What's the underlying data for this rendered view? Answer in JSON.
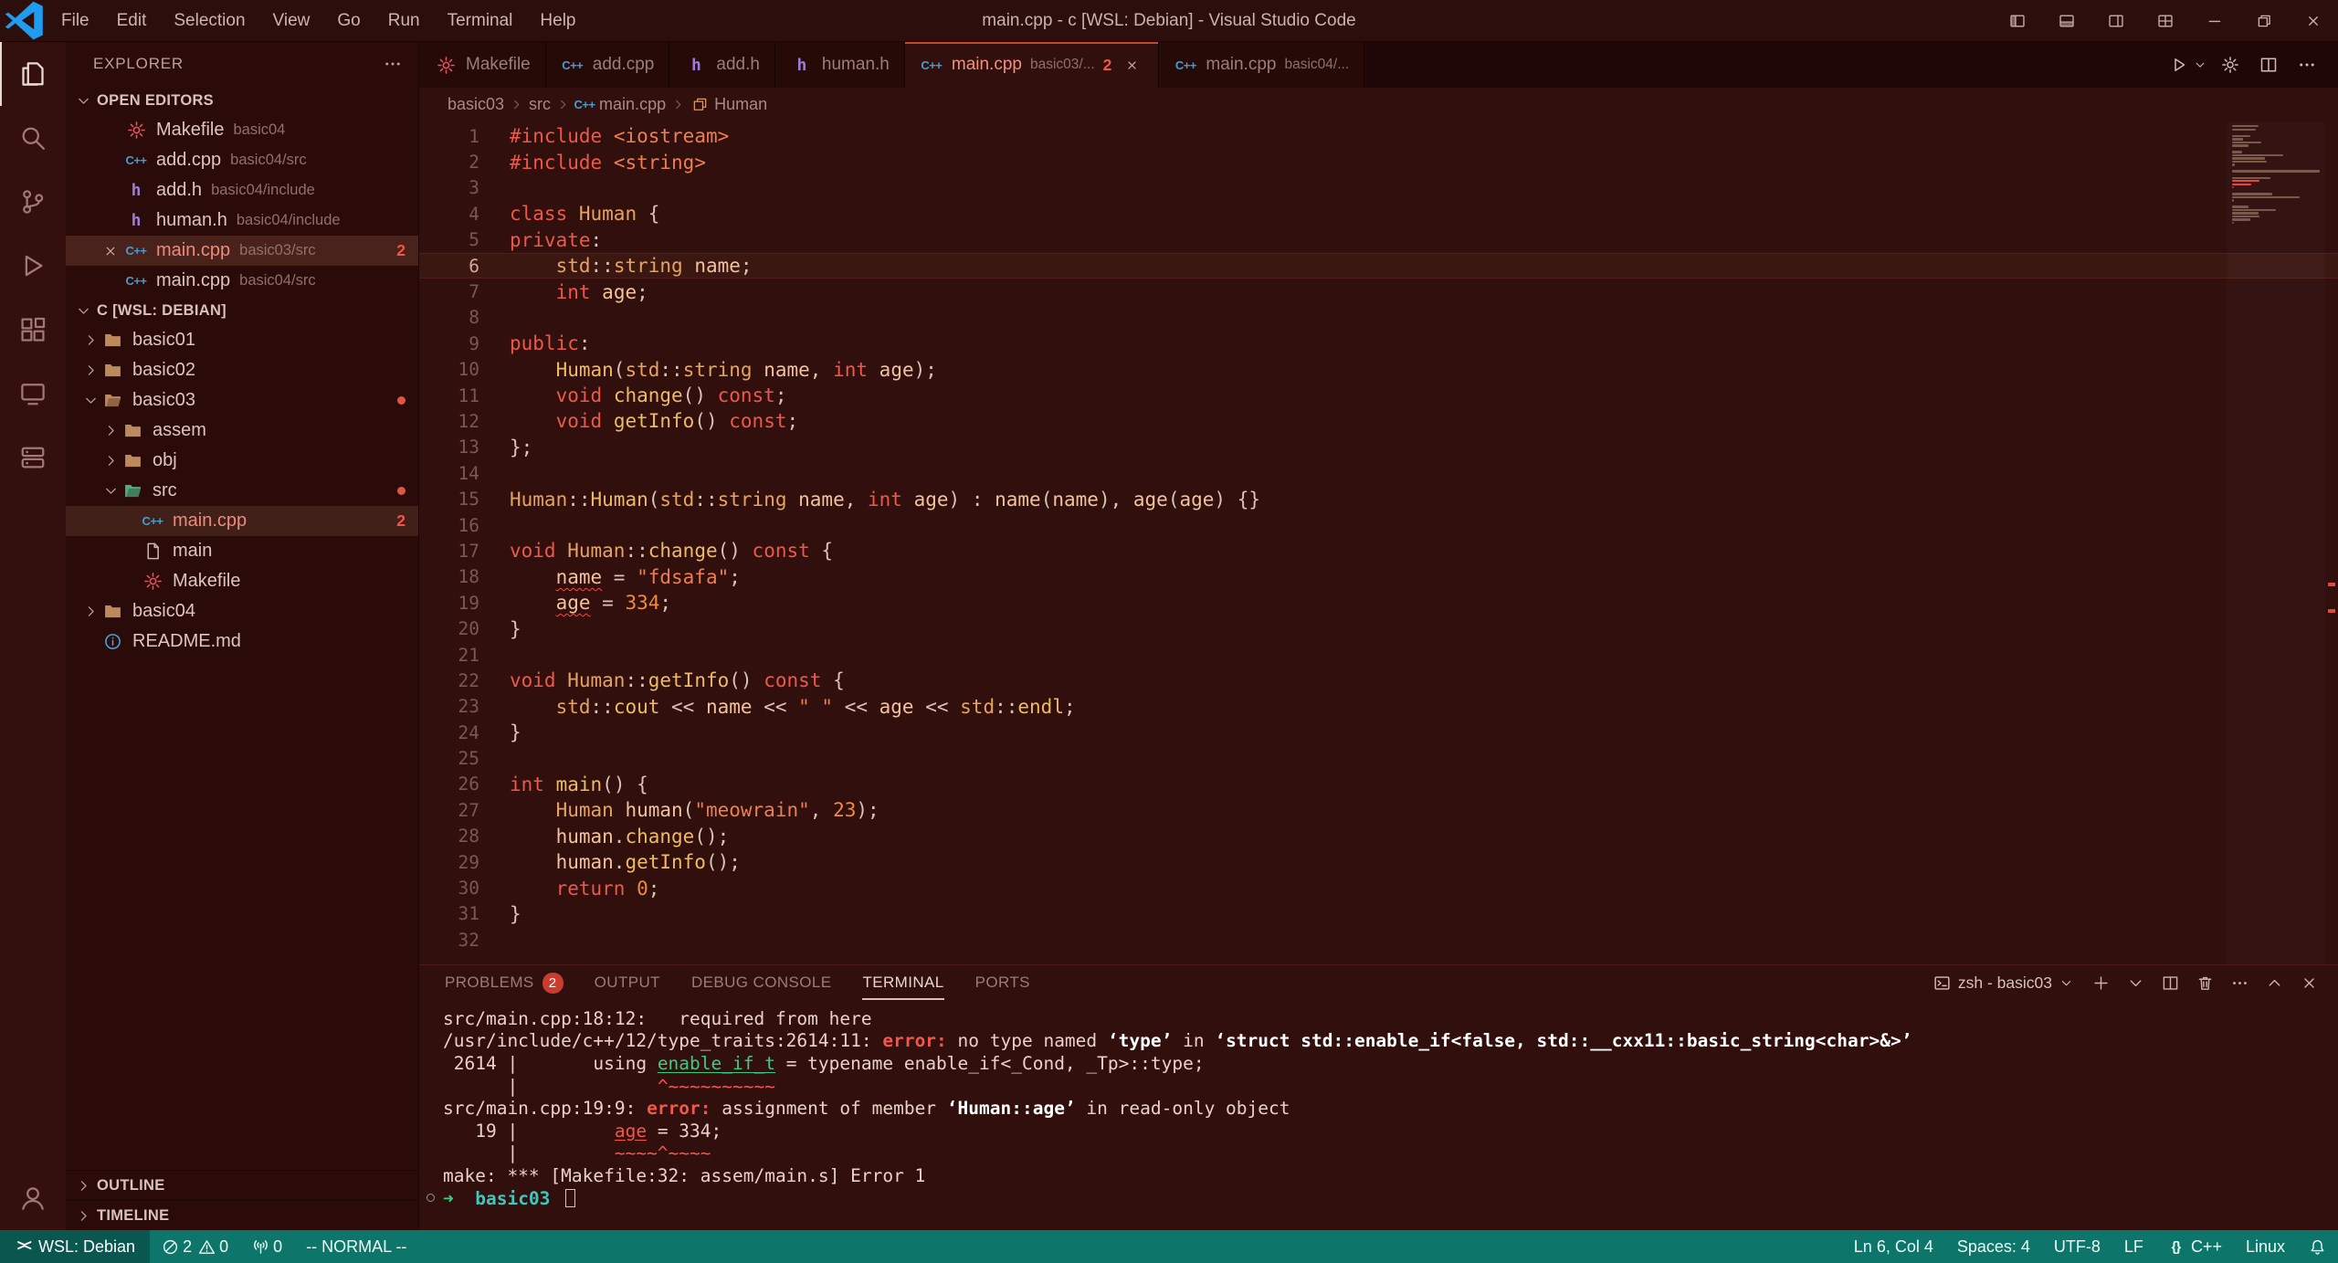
{
  "colors": {
    "error_red": "#f14c4c",
    "badge_red": "#ca3c2e",
    "statusbar_teal": "#0e756a",
    "remote_teal": "#0a5750",
    "logo_blue": "#1f9cf0",
    "accent_tab": "#c8492f"
  },
  "window": {
    "title": "main.cpp - c [WSL: Debian] - Visual Studio Code",
    "menus": [
      "File",
      "Edit",
      "Selection",
      "View",
      "Go",
      "Run",
      "Terminal",
      "Help"
    ]
  },
  "activity_bar": {
    "top": [
      {
        "name": "explorer",
        "icon": "files",
        "active": true
      },
      {
        "name": "search",
        "icon": "search",
        "active": false
      },
      {
        "name": "source-control",
        "icon": "git",
        "active": false
      },
      {
        "name": "run-and-debug",
        "icon": "debug",
        "active": false
      },
      {
        "name": "extensions",
        "icon": "extensions",
        "active": false
      },
      {
        "name": "remote-explorer",
        "icon": "remote",
        "active": false
      },
      {
        "name": "containers",
        "icon": "server",
        "active": false
      }
    ],
    "bottom": [
      {
        "name": "accounts",
        "icon": "account"
      }
    ]
  },
  "sidebar": {
    "title": "EXPLORER",
    "open_editors": {
      "label": "OPEN EDITORS",
      "items": [
        {
          "label": "Makefile",
          "desc": "basic04",
          "icon": "makefile"
        },
        {
          "label": "add.cpp",
          "desc": "basic04/src",
          "icon": "cpp"
        },
        {
          "label": "add.h",
          "desc": "basic04/include",
          "icon": "hfile"
        },
        {
          "label": "human.h",
          "desc": "basic04/include",
          "icon": "hfile"
        },
        {
          "label": "main.cpp",
          "desc": "basic03/src",
          "icon": "cpp",
          "active": true,
          "close": true,
          "badge": "2",
          "problem": true
        },
        {
          "label": "main.cpp",
          "desc": "basic04/src",
          "icon": "cpp"
        }
      ]
    },
    "workspace": {
      "label": "C [WSL: DEBIAN]",
      "tree": [
        {
          "label": "basic01",
          "icon": "folder",
          "indent": 0,
          "chevron": "collapsed"
        },
        {
          "label": "basic02",
          "icon": "folder",
          "indent": 0,
          "chevron": "collapsed"
        },
        {
          "label": "basic03",
          "icon": "folder-open",
          "indent": 0,
          "chevron": "expanded",
          "dot": true
        },
        {
          "label": "assem",
          "icon": "folder",
          "indent": 1,
          "chevron": "collapsed"
        },
        {
          "label": "obj",
          "icon": "folder",
          "indent": 1,
          "chevron": "collapsed"
        },
        {
          "label": "src",
          "icon": "folder-src",
          "indent": 1,
          "chevron": "expanded",
          "dot": true
        },
        {
          "label": "main.cpp",
          "icon": "cpp",
          "indent": 2,
          "selected": true,
          "badge": "2",
          "problem": true
        },
        {
          "label": "main",
          "icon": "file",
          "indent": 2
        },
        {
          "label": "Makefile",
          "icon": "makefile",
          "indent": 2
        },
        {
          "label": "basic04",
          "icon": "folder",
          "indent": 0,
          "chevron": "collapsed"
        },
        {
          "label": "README.md",
          "icon": "info",
          "indent": 0
        }
      ]
    },
    "outline_label": "OUTLINE",
    "timeline_label": "TIMELINE"
  },
  "tabs": {
    "items": [
      {
        "label": "Makefile",
        "icon": "makefile"
      },
      {
        "label": "add.cpp",
        "icon": "cpp"
      },
      {
        "label": "add.h",
        "icon": "hfile"
      },
      {
        "label": "human.h",
        "icon": "hfile"
      },
      {
        "label": "main.cpp",
        "desc": "basic03/...",
        "icon": "cpp",
        "active": true,
        "close": true,
        "badge": "2",
        "problem": true
      },
      {
        "label": "main.cpp",
        "desc": "basic04/...",
        "icon": "cpp"
      }
    ],
    "actions": [
      {
        "name": "run-button",
        "icon": "play"
      },
      {
        "name": "run-dropdown",
        "icon": "chevdown",
        "narrow": true
      },
      {
        "name": "settings-gear",
        "icon": "gear"
      },
      {
        "name": "split-editor",
        "icon": "split"
      },
      {
        "name": "editor-more-actions",
        "icon": "ellipsis"
      }
    ]
  },
  "breadcrumb": [
    {
      "label": "basic03"
    },
    {
      "label": "src"
    },
    {
      "label": "main.cpp",
      "icon": "cpp"
    },
    {
      "label": "Human",
      "icon": "classsym"
    }
  ],
  "editor": {
    "current_line": 6,
    "error_lines": [
      18,
      19
    ],
    "lines": [
      [
        [
          "#include",
          "k"
        ],
        [
          " ",
          "p"
        ],
        [
          "<iostream>",
          "s"
        ]
      ],
      [
        [
          "#include",
          "k"
        ],
        [
          " ",
          "p"
        ],
        [
          "<string>",
          "s"
        ]
      ],
      [],
      [
        [
          "class",
          "k"
        ],
        [
          " ",
          "p"
        ],
        [
          "Human",
          "t"
        ],
        [
          " {",
          "p"
        ]
      ],
      [
        [
          "private",
          "k"
        ],
        [
          ":",
          "p"
        ]
      ],
      [
        [
          "    ",
          "p"
        ],
        [
          "std",
          "t"
        ],
        [
          "::",
          "p"
        ],
        [
          "string",
          "t"
        ],
        [
          " ",
          "p"
        ],
        [
          "name",
          "v"
        ],
        [
          ";",
          "p"
        ]
      ],
      [
        [
          "    ",
          "p"
        ],
        [
          "int",
          "k"
        ],
        [
          " ",
          "p"
        ],
        [
          "age",
          "v"
        ],
        [
          ";",
          "p"
        ]
      ],
      [],
      [
        [
          "public",
          "k"
        ],
        [
          ":",
          "p"
        ]
      ],
      [
        [
          "    ",
          "p"
        ],
        [
          "Human",
          "f"
        ],
        [
          "(",
          "p"
        ],
        [
          "std",
          "t"
        ],
        [
          "::",
          "p"
        ],
        [
          "string",
          "t"
        ],
        [
          " ",
          "p"
        ],
        [
          "name",
          "v"
        ],
        [
          ", ",
          "p"
        ],
        [
          "int",
          "k"
        ],
        [
          " ",
          "p"
        ],
        [
          "age",
          "v"
        ],
        [
          ");",
          "p"
        ]
      ],
      [
        [
          "    ",
          "p"
        ],
        [
          "void",
          "k"
        ],
        [
          " ",
          "p"
        ],
        [
          "change",
          "f"
        ],
        [
          "() ",
          "p"
        ],
        [
          "const",
          "k"
        ],
        [
          ";",
          "p"
        ]
      ],
      [
        [
          "    ",
          "p"
        ],
        [
          "void",
          "k"
        ],
        [
          " ",
          "p"
        ],
        [
          "getInfo",
          "f"
        ],
        [
          "() ",
          "p"
        ],
        [
          "const",
          "k"
        ],
        [
          ";",
          "p"
        ]
      ],
      [
        [
          "};",
          "p"
        ]
      ],
      [],
      [
        [
          "Human",
          "t"
        ],
        [
          "::",
          "p"
        ],
        [
          "Human",
          "f"
        ],
        [
          "(",
          "p"
        ],
        [
          "std",
          "t"
        ],
        [
          "::",
          "p"
        ],
        [
          "string",
          "t"
        ],
        [
          " ",
          "p"
        ],
        [
          "name",
          "v"
        ],
        [
          ", ",
          "p"
        ],
        [
          "int",
          "k"
        ],
        [
          " ",
          "p"
        ],
        [
          "age",
          "v"
        ],
        [
          ") : ",
          "p"
        ],
        [
          "name",
          "v"
        ],
        [
          "(",
          "p"
        ],
        [
          "name",
          "v"
        ],
        [
          "), ",
          "p"
        ],
        [
          "age",
          "v"
        ],
        [
          "(",
          "p"
        ],
        [
          "age",
          "v"
        ],
        [
          ") {}",
          "p"
        ]
      ],
      [],
      [
        [
          "void",
          "k"
        ],
        [
          " ",
          "p"
        ],
        [
          "Human",
          "t"
        ],
        [
          "::",
          "p"
        ],
        [
          "change",
          "f"
        ],
        [
          "() ",
          "p"
        ],
        [
          "const",
          "k"
        ],
        [
          " {",
          "p"
        ]
      ],
      [
        [
          "    ",
          "p"
        ],
        [
          "name",
          "v sq"
        ],
        [
          " = ",
          "p"
        ],
        [
          "\"fdsafa\"",
          "s"
        ],
        [
          ";",
          "p"
        ]
      ],
      [
        [
          "    ",
          "p"
        ],
        [
          "age",
          "v sq"
        ],
        [
          " = ",
          "p"
        ],
        [
          "334",
          "n"
        ],
        [
          ";",
          "p"
        ]
      ],
      [
        [
          "}",
          "p"
        ]
      ],
      [],
      [
        [
          "void",
          "k"
        ],
        [
          " ",
          "p"
        ],
        [
          "Human",
          "t"
        ],
        [
          "::",
          "p"
        ],
        [
          "getInfo",
          "f"
        ],
        [
          "() ",
          "p"
        ],
        [
          "const",
          "k"
        ],
        [
          " {",
          "p"
        ]
      ],
      [
        [
          "    ",
          "p"
        ],
        [
          "std",
          "t"
        ],
        [
          "::",
          "p"
        ],
        [
          "cout",
          "f"
        ],
        [
          " << ",
          "p"
        ],
        [
          "name",
          "v"
        ],
        [
          " << ",
          "p"
        ],
        [
          "\" \"",
          "s"
        ],
        [
          " << ",
          "p"
        ],
        [
          "age",
          "v"
        ],
        [
          " << ",
          "p"
        ],
        [
          "std",
          "t"
        ],
        [
          "::",
          "p"
        ],
        [
          "endl",
          "f"
        ],
        [
          ";",
          "p"
        ]
      ],
      [
        [
          "}",
          "p"
        ]
      ],
      [],
      [
        [
          "int",
          "k"
        ],
        [
          " ",
          "p"
        ],
        [
          "main",
          "f"
        ],
        [
          "() {",
          "p"
        ]
      ],
      [
        [
          "    ",
          "p"
        ],
        [
          "Human",
          "t"
        ],
        [
          " ",
          "p"
        ],
        [
          "human",
          "v"
        ],
        [
          "(",
          "p"
        ],
        [
          "\"meowrain\"",
          "s"
        ],
        [
          ", ",
          "p"
        ],
        [
          "23",
          "n"
        ],
        [
          ");",
          "p"
        ]
      ],
      [
        [
          "    ",
          "p"
        ],
        [
          "human",
          "v"
        ],
        [
          ".",
          "p"
        ],
        [
          "change",
          "f"
        ],
        [
          "();",
          "p"
        ]
      ],
      [
        [
          "    ",
          "p"
        ],
        [
          "human",
          "v"
        ],
        [
          ".",
          "p"
        ],
        [
          "getInfo",
          "f"
        ],
        [
          "();",
          "p"
        ]
      ],
      [
        [
          "    ",
          "p"
        ],
        [
          "return",
          "k"
        ],
        [
          " ",
          "p"
        ],
        [
          "0",
          "n"
        ],
        [
          ";",
          "p"
        ]
      ],
      [
        [
          "}",
          "p"
        ]
      ],
      []
    ]
  },
  "panel": {
    "tabs": [
      {
        "label": "PROBLEMS",
        "badge": "2"
      },
      {
        "label": "OUTPUT"
      },
      {
        "label": "DEBUG CONSOLE"
      },
      {
        "label": "TERMINAL",
        "active": true
      },
      {
        "label": "PORTS"
      }
    ],
    "terminal_select": "zsh - basic03",
    "actions": [
      {
        "name": "new-terminal",
        "icon": "plus"
      },
      {
        "name": "launch-profile-dropdown",
        "icon": "chevdown"
      },
      {
        "name": "split-terminal",
        "icon": "split"
      },
      {
        "name": "kill-terminal",
        "icon": "trash"
      },
      {
        "name": "terminal-more-actions",
        "icon": "ellipsis"
      },
      {
        "name": "maximize-panel",
        "icon": "chevup"
      },
      {
        "name": "close-panel",
        "icon": "close"
      }
    ],
    "cursor_line": 9,
    "decoration_line": 9,
    "lines": [
      [
        [
          "src/main.cpp:18:12:   required from here",
          "td"
        ]
      ],
      [
        [
          "/usr/include/c++/12/type_traits:2614:11: ",
          "td"
        ],
        [
          "error: ",
          "ter"
        ],
        [
          "no type named ",
          "td"
        ],
        [
          "‘type’",
          "tb2"
        ],
        [
          " in ",
          "td"
        ],
        [
          "‘struct std::enable_if<false, std::__cxx11::basic_string<char>&>’",
          "tb2"
        ]
      ],
      [
        [
          " 2614 |       using ",
          "td"
        ],
        [
          "enable_if_t",
          "tg"
        ],
        [
          " = typename enable_if<_Cond, _Tp>::type;",
          "td"
        ]
      ],
      [
        [
          "      |             ",
          "td"
        ],
        [
          "^~~~~~~~~~~",
          "tr"
        ]
      ],
      [
        [
          "src/main.cpp:19:9: ",
          "td"
        ],
        [
          "error: ",
          "ter"
        ],
        [
          "assignment of member ",
          "td"
        ],
        [
          "‘Human::age’",
          "tb2"
        ],
        [
          " in read-only object",
          "td"
        ]
      ],
      [
        [
          "   19 |         ",
          "td"
        ],
        [
          "age",
          "tru"
        ],
        [
          " = 334;",
          "td"
        ]
      ],
      [
        [
          "      |         ",
          "td"
        ],
        [
          "~~~~^~~~~",
          "tr"
        ]
      ],
      [
        [
          "make: *** [Makefile:32: assem/main.s] Error 1",
          "td"
        ]
      ],
      [
        [
          "➜  ",
          "tar"
        ],
        [
          "basic03",
          "tcy"
        ],
        [
          " ",
          "td"
        ]
      ]
    ]
  },
  "status_bar": {
    "remote": "WSL: Debian",
    "errors": "2",
    "warnings": "0",
    "ports": "0",
    "mode": "-- NORMAL --",
    "right": [
      {
        "name": "cursor-position",
        "label": "Ln 6, Col 4"
      },
      {
        "name": "indentation",
        "label": "Spaces: 4"
      },
      {
        "name": "encoding",
        "label": "UTF-8"
      },
      {
        "name": "eol",
        "label": "LF"
      },
      {
        "name": "language-mode",
        "label": "C++",
        "icon": "braces"
      },
      {
        "name": "os-host",
        "label": "Linux"
      },
      {
        "name": "notifications",
        "icon": "bell"
      }
    ]
  }
}
